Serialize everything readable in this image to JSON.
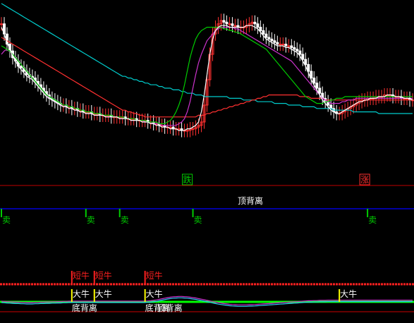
{
  "chart_data": [
    {
      "type": "candlestick",
      "panel": "price",
      "title": "",
      "xlabel": "",
      "ylabel": "",
      "ylim": [
        0,
        100
      ],
      "x_count": 147,
      "candles_close": [
        88,
        82,
        76,
        72,
        68,
        66,
        63,
        62,
        60,
        58,
        57,
        56,
        54,
        52,
        50,
        48,
        46,
        44,
        43,
        42,
        41,
        40,
        40,
        39,
        39,
        38,
        38,
        37,
        37,
        36,
        36,
        36,
        35,
        35,
        35,
        34,
        34,
        34,
        34,
        33,
        33,
        33,
        33,
        33,
        32,
        32,
        32,
        32,
        31,
        31,
        31,
        31,
        30,
        30,
        29,
        29,
        28,
        28,
        27,
        27,
        27,
        26,
        26,
        26,
        25,
        25,
        25,
        26,
        26,
        27,
        28,
        30,
        40,
        55,
        70,
        82,
        86,
        88,
        90,
        89,
        88,
        88,
        87,
        87,
        86,
        86,
        86,
        87,
        88,
        89,
        88,
        86,
        84,
        82,
        80,
        79,
        78,
        77,
        76,
        76,
        76,
        75,
        75,
        74,
        73,
        72,
        70,
        67,
        64,
        60,
        56,
        53,
        50,
        47,
        44,
        42,
        40,
        38,
        36,
        35,
        35,
        36,
        37,
        38,
        39,
        40,
        41,
        42,
        43,
        43,
        44,
        44,
        44,
        45,
        45,
        45,
        46,
        46,
        46,
        45,
        45,
        45,
        44,
        44,
        44,
        43,
        43
      ],
      "series": [
        {
          "name": "",
          "color": "#00cccc",
          "values": [
            100,
            99,
            98,
            97,
            96,
            95,
            94,
            93,
            92,
            91,
            90,
            89,
            88,
            87,
            86,
            85,
            84,
            83,
            82,
            81,
            80,
            79,
            78,
            77,
            76,
            75,
            74,
            73,
            72,
            71,
            70,
            69,
            68,
            67,
            66,
            65,
            64,
            63,
            62,
            61,
            60,
            59,
            58,
            57,
            57,
            56,
            56,
            55,
            55,
            54,
            54,
            53,
            53,
            52,
            52,
            52,
            51,
            51,
            50,
            50,
            50,
            49,
            49,
            49,
            48,
            48,
            47,
            47,
            47,
            46,
            46,
            46,
            45,
            45,
            45,
            45,
            45,
            45,
            45,
            45,
            45,
            44,
            44,
            44,
            44,
            44,
            43,
            43,
            43,
            43,
            43,
            42,
            42,
            42,
            42,
            42,
            42,
            41,
            41,
            41,
            41,
            41,
            40,
            40,
            40,
            40,
            40,
            39,
            39,
            39,
            39,
            39,
            38,
            38,
            38,
            38,
            38,
            38,
            37,
            37,
            37,
            37,
            37,
            37,
            37,
            36,
            36,
            36,
            36,
            36,
            36,
            36,
            36,
            36,
            35,
            35,
            35,
            35,
            35,
            35,
            35,
            35,
            35,
            35,
            35,
            35,
            35
          ]
        },
        {
          "name": "",
          "color": "#ff3030",
          "values": [
            80,
            79,
            78,
            77,
            76,
            75,
            74,
            73,
            72,
            71,
            70,
            69,
            68,
            67,
            66,
            65,
            64,
            63,
            62,
            61,
            60,
            59,
            58,
            57,
            56,
            55,
            54,
            53,
            52,
            51,
            50,
            49,
            48,
            47,
            46,
            45,
            44,
            43,
            42,
            41,
            40,
            39,
            38,
            37,
            37,
            36,
            36,
            35,
            35,
            34,
            34,
            33,
            33,
            33,
            33,
            33,
            33,
            33,
            33,
            33,
            33,
            33,
            33,
            33,
            33,
            33,
            33,
            33,
            33,
            33,
            34,
            34,
            34,
            35,
            35,
            36,
            36,
            37,
            37,
            38,
            38,
            39,
            39,
            40,
            40,
            41,
            41,
            42,
            42,
            43,
            43,
            44,
            44,
            45,
            45,
            46,
            46,
            46,
            46,
            46,
            46,
            46,
            46,
            46,
            46,
            46,
            45,
            45,
            45,
            45,
            44,
            44,
            44,
            44,
            44,
            43,
            43,
            43,
            43,
            43,
            43,
            43,
            43,
            43,
            43,
            43,
            43,
            43,
            43,
            43,
            43,
            43,
            43,
            43,
            43,
            43,
            43,
            43,
            43,
            43,
            43,
            43,
            43,
            43,
            43,
            43,
            43
          ]
        },
        {
          "name": "",
          "color": "#cc33cc",
          "values": [
            70,
            72,
            73,
            72,
            70,
            68,
            66,
            64,
            62,
            60,
            58,
            56,
            54,
            52,
            50,
            48,
            46,
            44,
            43,
            42,
            41,
            40,
            40,
            39,
            38,
            38,
            37,
            37,
            36,
            36,
            35,
            35,
            35,
            34,
            34,
            34,
            34,
            33,
            33,
            33,
            33,
            33,
            32,
            32,
            32,
            32,
            31,
            31,
            31,
            31,
            31,
            30,
            30,
            30,
            29,
            29,
            29,
            28,
            28,
            28,
            28,
            28,
            28,
            29,
            30,
            32,
            36,
            42,
            50,
            58,
            65,
            70,
            74,
            78,
            80,
            82,
            84,
            85,
            86,
            86,
            86,
            86,
            86,
            85,
            85,
            84,
            83,
            82,
            81,
            80,
            79,
            78,
            77,
            76,
            75,
            74,
            73,
            72,
            71,
            70,
            69,
            68,
            67,
            66,
            64,
            62,
            60,
            58,
            56,
            54,
            52,
            50,
            48,
            46,
            44,
            43,
            42,
            41,
            41,
            41,
            41,
            42,
            42,
            43,
            43,
            43,
            44,
            44,
            44,
            44,
            44,
            44,
            44,
            44,
            44,
            44,
            44,
            44,
            44,
            44,
            44,
            44,
            44,
            44,
            44,
            44,
            44
          ]
        },
        {
          "name": "",
          "color": "#00cc00",
          "values": [
            75,
            74,
            73,
            72,
            70,
            68,
            66,
            64,
            62,
            60,
            58,
            56,
            54,
            52,
            50,
            48,
            46,
            45,
            44,
            43,
            42,
            41,
            40,
            40,
            39,
            39,
            38,
            38,
            37,
            37,
            36,
            36,
            36,
            35,
            35,
            35,
            34,
            34,
            34,
            34,
            33,
            33,
            33,
            33,
            32,
            32,
            32,
            32,
            31,
            31,
            31,
            31,
            30,
            30,
            30,
            30,
            29,
            29,
            29,
            30,
            31,
            33,
            36,
            40,
            45,
            52,
            60,
            68,
            74,
            79,
            82,
            84,
            85,
            86,
            86,
            86,
            86,
            86,
            86,
            85,
            85,
            84,
            84,
            83,
            83,
            82,
            81,
            80,
            79,
            78,
            77,
            76,
            75,
            74,
            73,
            71,
            69,
            67,
            65,
            63,
            61,
            59,
            57,
            55,
            53,
            51,
            49,
            47,
            45,
            44,
            43,
            42,
            41,
            41,
            41,
            42,
            42,
            43,
            43,
            44,
            44,
            44,
            45,
            45,
            45,
            45,
            45,
            45,
            45,
            45,
            45,
            45,
            45,
            45,
            45,
            45,
            45,
            45,
            45,
            45,
            45,
            45,
            45,
            45,
            45,
            45,
            45
          ]
        },
        {
          "name": "",
          "color": "#ffffff",
          "values": [
            86,
            82,
            77,
            73,
            69,
            66,
            63,
            61,
            59,
            57,
            56,
            55,
            53,
            51,
            49,
            47,
            45,
            44,
            43,
            42,
            41,
            40,
            39,
            39,
            38,
            38,
            37,
            37,
            36,
            36,
            35,
            35,
            35,
            34,
            34,
            34,
            34,
            33,
            33,
            33,
            33,
            33,
            32,
            32,
            32,
            32,
            31,
            31,
            31,
            31,
            30,
            30,
            30,
            29,
            29,
            28,
            28,
            27,
            27,
            27,
            26,
            26,
            26,
            25,
            25,
            25,
            26,
            26,
            27,
            28,
            30,
            36,
            46,
            58,
            70,
            79,
            84,
            86,
            87,
            87,
            87,
            86,
            86,
            86,
            86,
            86,
            86,
            87,
            87,
            87,
            86,
            85,
            83,
            81,
            79,
            78,
            77,
            76,
            75,
            75,
            75,
            74,
            74,
            73,
            72,
            71,
            69,
            66,
            63,
            59,
            55,
            52,
            49,
            46,
            43,
            41,
            39,
            37,
            36,
            35,
            35,
            36,
            37,
            38,
            39,
            40,
            41,
            42,
            42,
            43,
            43,
            44,
            44,
            44,
            45,
            45,
            45,
            46,
            46,
            46,
            45,
            45,
            45,
            44,
            44,
            44,
            43
          ]
        }
      ],
      "annotations": [
        {
          "text": "跌",
          "x_index": 66,
          "color": "#00cc00"
        },
        {
          "text": "涨",
          "x_index": 129,
          "color": "#ff3030"
        }
      ]
    },
    {
      "type": "signal",
      "panel": "divergence",
      "title": "顶背离",
      "line_color": "#0000ff",
      "marks": [
        {
          "text": "卖",
          "x_index": 0
        },
        {
          "text": "卖",
          "x_index": 30
        },
        {
          "text": "卖",
          "x_index": 42
        },
        {
          "text": "卖",
          "x_index": 68
        },
        {
          "text": "卖",
          "x_index": 130
        }
      ]
    },
    {
      "type": "signal",
      "panel": "indicator",
      "title": "",
      "signals": [
        {
          "x_index": 25,
          "labels": [
            "短牛",
            "大牛",
            "底背离"
          ]
        },
        {
          "x_index": 33,
          "labels": [
            "短牛",
            "大牛"
          ]
        },
        {
          "x_index": 51,
          "labels": [
            "短牛",
            "大牛",
            "底背离"
          ]
        },
        {
          "x_index": 59,
          "labels": [
            "顶背离"
          ]
        },
        {
          "x_index": 120,
          "labels": [
            "大牛"
          ]
        }
      ],
      "osc_values": [
        50,
        49,
        48,
        47,
        46,
        45,
        45,
        44,
        44,
        43,
        43,
        43,
        44,
        44,
        45,
        45,
        46,
        46,
        47,
        47,
        48,
        48,
        49,
        49,
        50,
        50,
        50,
        50,
        50,
        50,
        50,
        50,
        50,
        50,
        50,
        50,
        50,
        50,
        50,
        50,
        50,
        50,
        50,
        50,
        50,
        50,
        50,
        50,
        50,
        50,
        50,
        50,
        51,
        52,
        54,
        56,
        59,
        62,
        65,
        68,
        70,
        72,
        73,
        74,
        74,
        73,
        72,
        70,
        68,
        66,
        63,
        60,
        57,
        54,
        51,
        48,
        45,
        42,
        40,
        38,
        36,
        34,
        33,
        32,
        31,
        31,
        31,
        31,
        32,
        32,
        33,
        34,
        35,
        36,
        37,
        38,
        39,
        40,
        41,
        42,
        43,
        44,
        45,
        46,
        47,
        48,
        49,
        50,
        51,
        52,
        52,
        53,
        53,
        54,
        54,
        54,
        55,
        55,
        55,
        55,
        55,
        55,
        55,
        55,
        55,
        55,
        55,
        55,
        55,
        55,
        55,
        55,
        55,
        55,
        55,
        55,
        55,
        55,
        55,
        55,
        55,
        55,
        55,
        55,
        55,
        55,
        55
      ]
    }
  ]
}
